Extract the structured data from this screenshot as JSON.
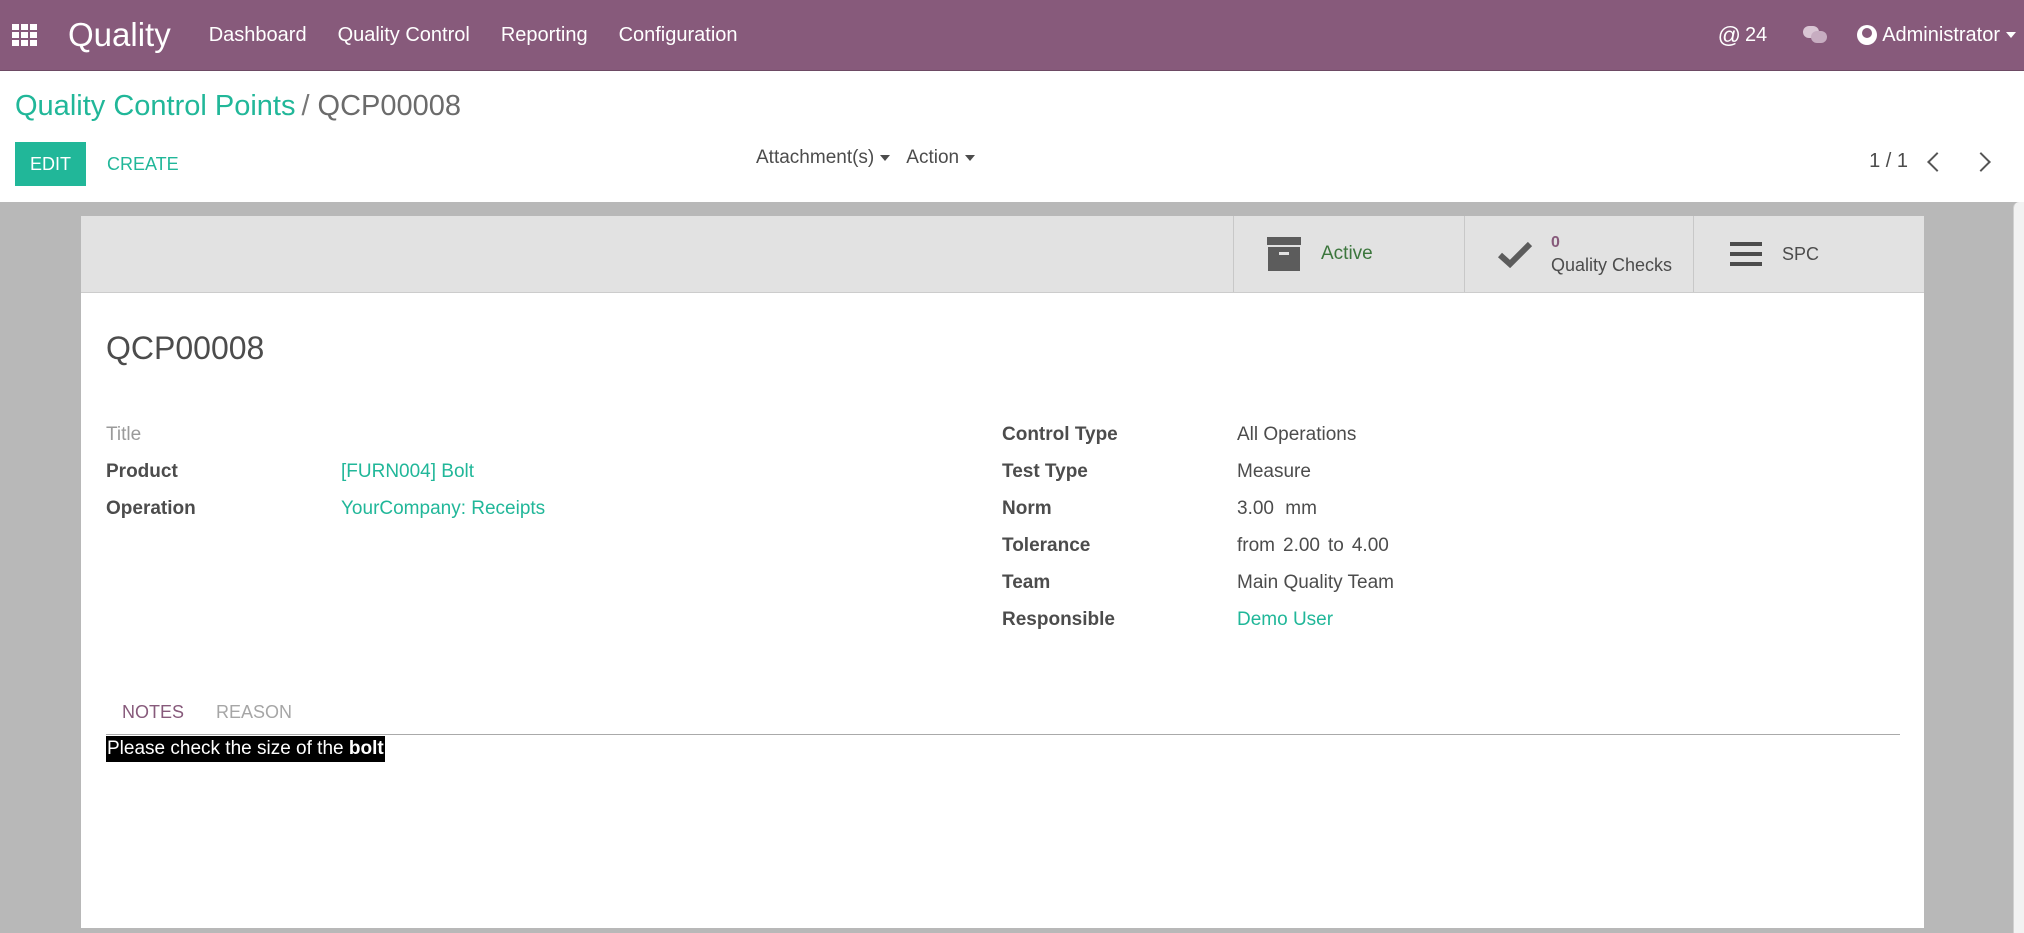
{
  "navbar": {
    "brand": "Quality",
    "menu": [
      "Dashboard",
      "Quality Control",
      "Reporting",
      "Configuration"
    ],
    "mentions_count": "24",
    "user": "Administrator",
    "color": "#875a7b"
  },
  "breadcrumb": {
    "parent": "Quality Control Points",
    "separator": "/",
    "current": "QCP00008"
  },
  "actions": {
    "edit": "EDIT",
    "create": "CREATE",
    "attachments": "Attachment(s)",
    "action": "Action"
  },
  "pager": {
    "value": "1 / 1"
  },
  "stat_buttons": {
    "active": "Active",
    "checks_count": "0",
    "checks_label": "Quality Checks",
    "spc": "SPC"
  },
  "record": {
    "name": "QCP00008",
    "left_fields": [
      {
        "label": "Title",
        "value": ""
      },
      {
        "label": "Product",
        "value": "[FURN004] Bolt"
      },
      {
        "label": "Operation",
        "value": "YourCompany: Receipts"
      }
    ],
    "right_fields": [
      {
        "label": "Control Type",
        "value": "All Operations"
      },
      {
        "label": "Test Type",
        "value": "Measure"
      },
      {
        "label": "Norm",
        "value": "3.00",
        "unit": "mm"
      },
      {
        "label": "Tolerance",
        "from_label": "from",
        "from": "2.00",
        "to_label": "to",
        "to": "4.00"
      },
      {
        "label": "Team",
        "value": "Main Quality Team"
      },
      {
        "label": "Responsible",
        "value": "Demo User"
      }
    ]
  },
  "tabs": [
    "NOTES",
    "REASON"
  ],
  "notes": {
    "text": "Please check the size of the ",
    "bold": "bolt"
  },
  "colors": {
    "accent": "#21b799",
    "brand": "#875a7b",
    "active_green": "#3c763d"
  }
}
